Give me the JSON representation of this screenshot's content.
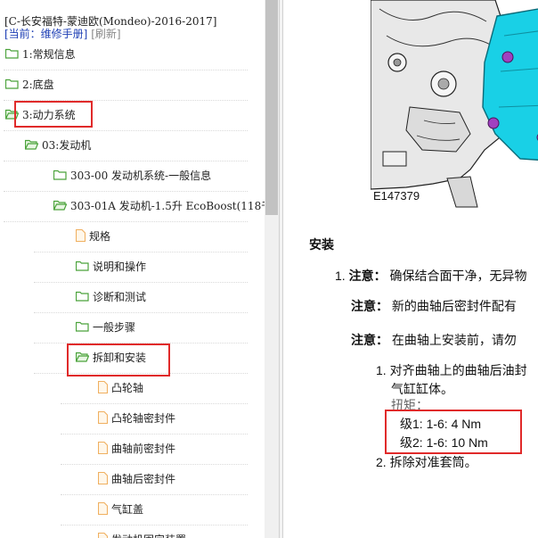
{
  "header": {
    "title": "[C-长安福特-蒙迪欧(Mondeo)-2016-2017]",
    "current": "[当前：维修手册]",
    "refresh": "[刷新]"
  },
  "tree": [
    {
      "label": "1:常规信息",
      "level": 0,
      "icon": "folder"
    },
    {
      "label": "2:底盘",
      "level": 0,
      "icon": "folder"
    },
    {
      "label": "3:动力系统",
      "level": 0,
      "icon": "folder-open",
      "highlighted": true
    },
    {
      "label": "03:发动机",
      "level": 1,
      "icon": "folder-open"
    },
    {
      "label": "303-00 发动机系统-一般信息",
      "level": 2,
      "icon": "folder"
    },
    {
      "label": "303-01A 发动机-1.5升 EcoBoost(118千",
      "level": 2,
      "icon": "folder-open"
    },
    {
      "label": "规格",
      "level": 3,
      "icon": "document"
    },
    {
      "label": "说明和操作",
      "level": 3,
      "icon": "folder"
    },
    {
      "label": "诊断和测试",
      "level": 3,
      "icon": "folder"
    },
    {
      "label": "一般步骤",
      "level": 3,
      "icon": "folder"
    },
    {
      "label": "拆卸和安装",
      "level": 3,
      "icon": "folder-open",
      "highlighted": true
    },
    {
      "label": "凸轮轴",
      "level": 4,
      "icon": "document"
    },
    {
      "label": "凸轮轴密封件",
      "level": 4,
      "icon": "document"
    },
    {
      "label": "曲轴前密封件",
      "level": 4,
      "icon": "document"
    },
    {
      "label": "曲轴后密封件",
      "level": 4,
      "icon": "document"
    },
    {
      "label": "气缸盖",
      "level": 4,
      "icon": "document"
    },
    {
      "label": "发动机固定装置",
      "level": 4,
      "icon": "document"
    }
  ],
  "document": {
    "figure_id": "E147379",
    "section_title": "安装",
    "step1_num": "1.",
    "note_label": "注意：",
    "note1": "确保结合面干净，无异物",
    "note2": "新的曲轴后密封件配有",
    "note3": "在曲轴上安装前，请勿",
    "sub1_num": "1.",
    "sub1_text_a": "对齐曲轴上的曲轴后油封",
    "sub1_text_b": "气缸缸体。",
    "torque_label": "扭矩：",
    "torque_stage1": "级1:  1-6:   4 Nm",
    "torque_stage2": "级2:  1-6:   10 Nm",
    "sub2_num": "2.",
    "sub2_text": "拆除对准套筒。"
  },
  "colors": {
    "highlight": "#e02a2a",
    "link_blue": "#1e3fb5",
    "folder_green": "#4aa23a",
    "document_orange": "#f0b060",
    "part_cyan": "#19d0e6",
    "bolt_purple": "#a040c0"
  }
}
